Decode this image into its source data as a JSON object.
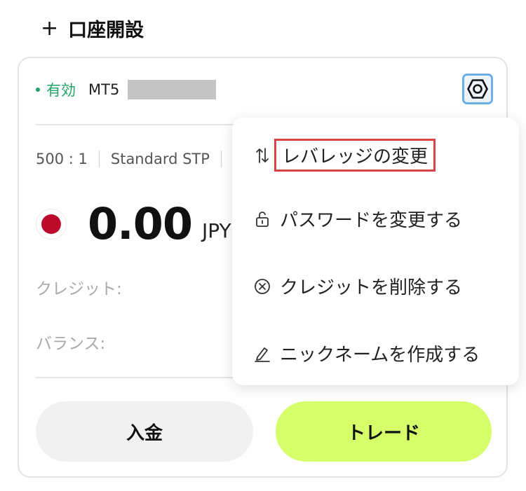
{
  "header": {
    "open_account_label": "口座開設"
  },
  "account": {
    "status": "有効",
    "platform": "MT5",
    "leverage": "500 : 1",
    "account_type": "Standard STP",
    "balance": "0.00",
    "currency": "JPY",
    "credit_label": "クレジット:",
    "balance_label": "バランス:"
  },
  "buttons": {
    "deposit": "入金",
    "trade": "トレード"
  },
  "menu": {
    "items": [
      {
        "label": "レバレッジの変更",
        "icon": "swap-arrows-icon"
      },
      {
        "label": "パスワードを変更する",
        "icon": "lock-icon"
      },
      {
        "label": "クレジットを削除する",
        "icon": "circle-x-icon"
      },
      {
        "label": "ニックネームを作成する",
        "icon": "pencil-icon"
      }
    ]
  },
  "colors": {
    "status_green": "#21a366",
    "trade_button": "#d6fd6a",
    "flag_red": "#bc0a2d",
    "highlight_red": "#d94343",
    "gear_border": "#6aaeea"
  }
}
